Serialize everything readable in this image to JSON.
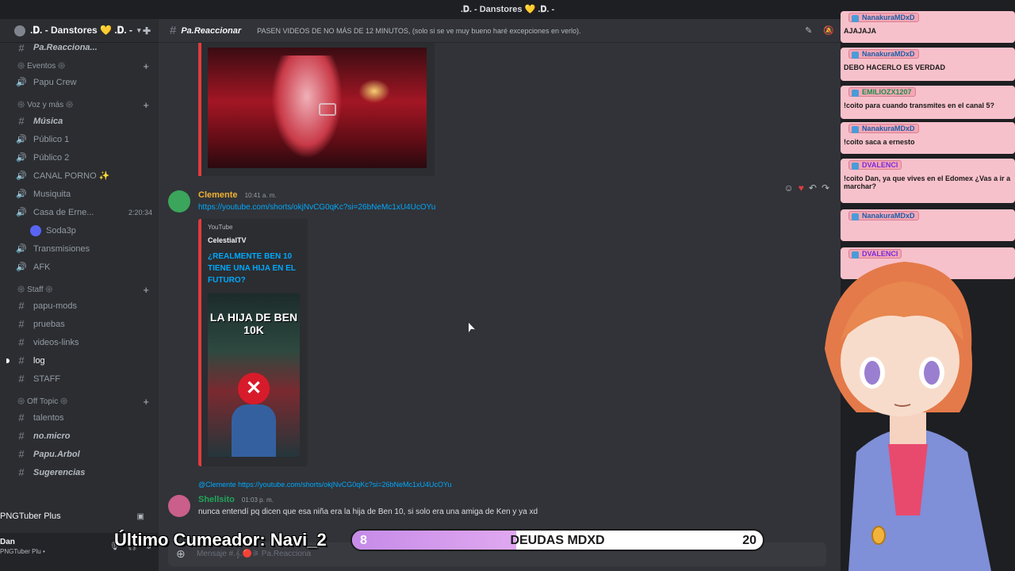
{
  "window": {
    "title": ".⁠𝐃⁠. - Danstores 💛 .𝐃⁠. -"
  },
  "server": {
    "name": ".𝐃. - Danstores 💛 .𝐃. -"
  },
  "sidebar": {
    "top_channel": "Pa.Reacciona...",
    "items": [
      {
        "type": "category",
        "label": "𑁍⁠ Eventos 𑁍"
      },
      {
        "type": "voice",
        "label": "Papu Crew"
      },
      {
        "type": "category",
        "label": "𑁍⁠ Voz y más 𑁍"
      },
      {
        "type": "text",
        "label": "Música",
        "italic": true
      },
      {
        "type": "voice",
        "label": "Público 1"
      },
      {
        "type": "voice",
        "label": "Público 2"
      },
      {
        "type": "voice",
        "label": "CANAL PORNO ✨"
      },
      {
        "type": "voice",
        "label": "Musiquita"
      },
      {
        "type": "voice",
        "label": "Casa de Erne...",
        "time": "2:20:34"
      },
      {
        "type": "member",
        "label": "Soda3p"
      },
      {
        "type": "voice",
        "label": "Transmisiones"
      },
      {
        "type": "voice",
        "label": "AFK"
      },
      {
        "type": "category",
        "label": "𑁍⁠ Staff 𑁍"
      },
      {
        "type": "text",
        "label": "papu-mods"
      },
      {
        "type": "text",
        "label": "pruebas"
      },
      {
        "type": "text",
        "label": "videos-links"
      },
      {
        "type": "text",
        "label": "log",
        "active": true
      },
      {
        "type": "text",
        "label": "STAFF"
      },
      {
        "type": "category",
        "label": "𑁍⁠ Off Topic 𑁍"
      },
      {
        "type": "text",
        "label": "talentos"
      },
      {
        "type": "text",
        "label": "no.micro",
        "italic": true
      },
      {
        "type": "text",
        "label": "Papu.Arbol",
        "italic": true
      },
      {
        "type": "text",
        "label": "Sugerencias",
        "italic": true
      }
    ],
    "pngtuber": "PNGTuber Plus",
    "user": {
      "name": "Dan",
      "status": "PNGTuber Plu •"
    }
  },
  "header": {
    "channel": "Pa.Reaccionar",
    "topic": "PASEN VIDEOS DE NO MÁS DE 12 MINUTOS, (solo si se ve muy bueno haré excepciones en verlo)."
  },
  "messages": [
    {
      "author": "Clemente",
      "author_color": "#f0b232",
      "time": "10:41 a. m.",
      "link": "https://youtube.com/shorts/okjNvCG0qKc?si=26bNeMc1xU4UcOYu",
      "embed": {
        "provider": "YouTube",
        "author": "CelestialTV",
        "title": "¿REALMENTE BEN 10 TIENE UNA HIJA EN EL FUTURO?",
        "thumb_text": "LA HIJA DE BEN 10K"
      }
    },
    {
      "reply_to": "@Clemente",
      "reply_link": "https://youtube.com/shorts/okjNvCG0qKc?si=26bNeMc1xU4UcOYu",
      "author": "Shellsito",
      "author_color": "#23a55a",
      "time": "01:03 p. m.",
      "text": "nunca entendí pq dicen que esa niña era la hija de Ben 10, si solo era una amiga de Ken y ya xd"
    }
  ],
  "composer": {
    "placeholder": "Mensaje #.𝄞.🔴⚞ Pa.Reacciona"
  },
  "stream_chat": [
    {
      "user": "NanakuraMDxD",
      "text": "AJAJAJA",
      "user_color": "#1b5ea8"
    },
    {
      "user": "NanakuraMDxD",
      "text": "DEBO HACERLO ES VERDAD",
      "user_color": "#1b5ea8"
    },
    {
      "user": "EMILIOZX1207",
      "text": "!coito para cuando transmites en el canal 5?",
      "user_color": "#1a8f4a"
    },
    {
      "user": "NanakuraMDxD",
      "text": "!coito saca a ernesto",
      "user_color": "#1b5ea8"
    },
    {
      "user": "DVALENCI",
      "text": "!coito Dan, ya que vives en el Edomex ¿Vas a ir a marchar?",
      "user_color": "#7a2bd8"
    },
    {
      "user": "NanakuraMDxD",
      "text": "",
      "user_color": "#1b5ea8"
    },
    {
      "user": "DVALENCI",
      "text": "",
      "user_color": "#7a2bd8"
    }
  ],
  "overlay": {
    "last_cum": "Último Cumeador: Navi_2",
    "goal": {
      "title": "DEUDAS MDXD",
      "current": "8",
      "max": "20",
      "fraction": 0.4
    }
  }
}
